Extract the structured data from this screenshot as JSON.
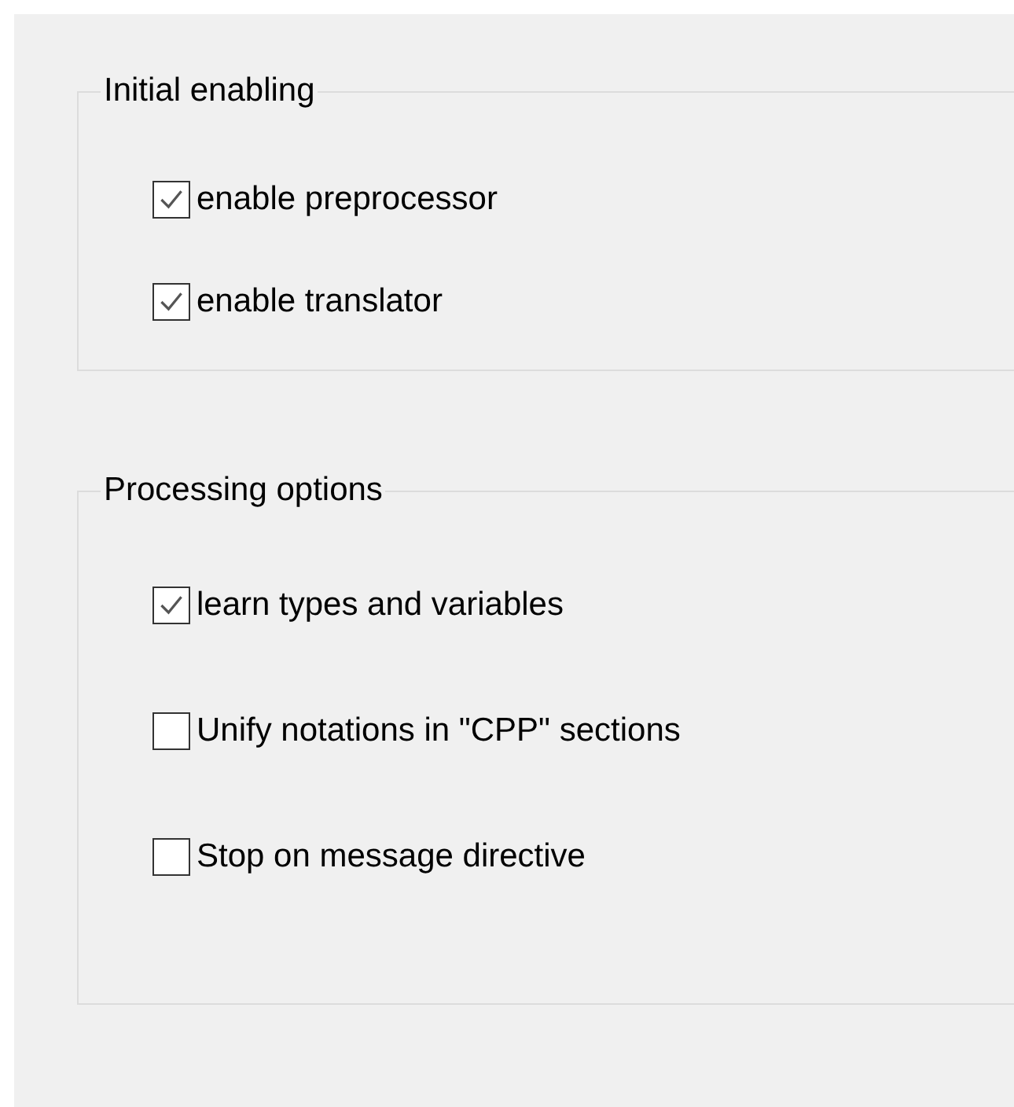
{
  "groups": [
    {
      "title": "Initial enabling",
      "options": [
        {
          "label": "enable preprocessor",
          "checked": true
        },
        {
          "label": "enable translator",
          "checked": true
        }
      ]
    },
    {
      "title": "Processing options",
      "options": [
        {
          "label": "learn types and variables",
          "checked": true
        },
        {
          "label": "Unify notations in \"CPP\" sections",
          "checked": false
        },
        {
          "label": "Stop on message directive",
          "checked": false
        }
      ]
    }
  ]
}
